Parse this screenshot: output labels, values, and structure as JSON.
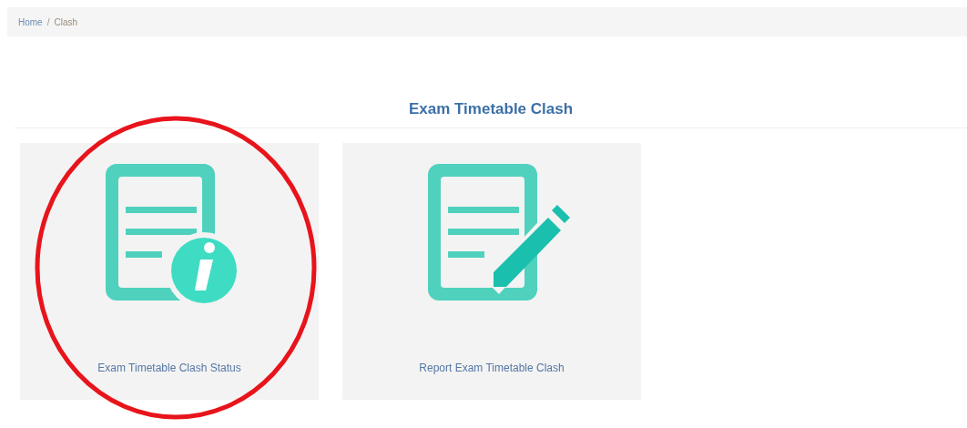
{
  "breadcrumb_separator": "/",
  "breadcrumb": [
    {
      "label": "Home",
      "current": false
    },
    {
      "label": "Clash",
      "current": true
    }
  ],
  "heading": "Exam Timetable Clash",
  "cards": [
    {
      "kind": "info",
      "label": "Exam Timetable Clash Status",
      "circled": true
    },
    {
      "kind": "edit",
      "label": "Report Exam Timetable Clash",
      "circled": false
    }
  ]
}
